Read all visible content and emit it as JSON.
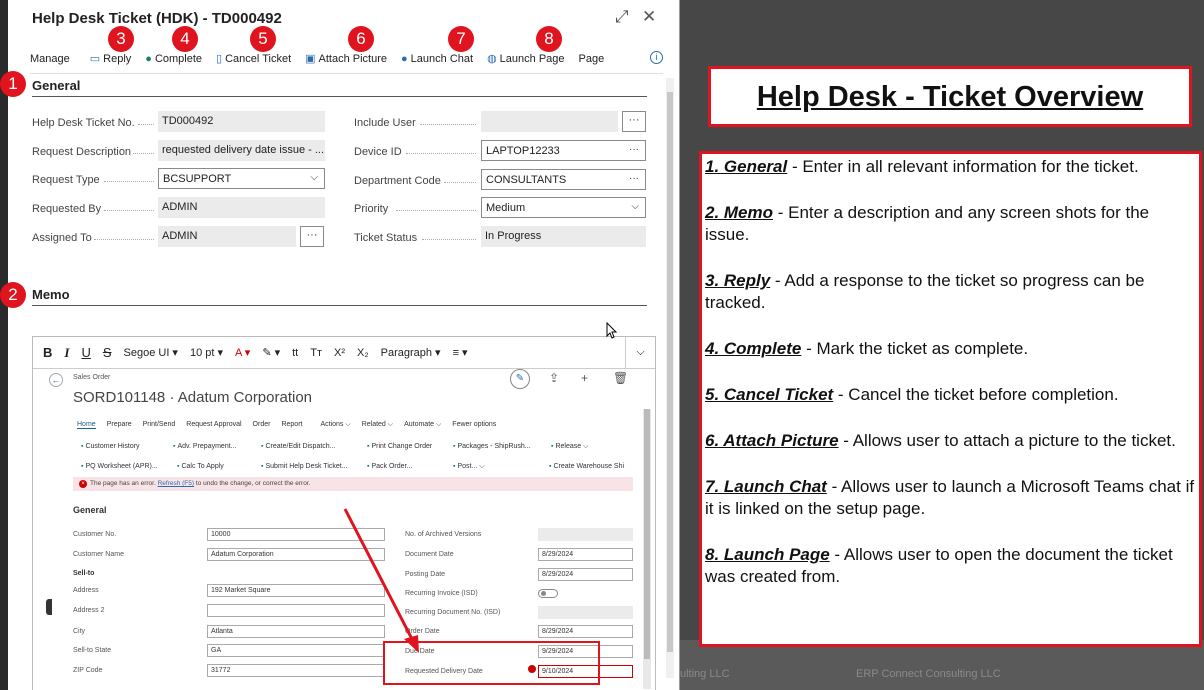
{
  "dialog": {
    "title": "Help Desk Ticket (HDK) - TD000492",
    "expand_glyph": "⤢",
    "close_glyph": "✕",
    "toolbar": {
      "manage": "Manage",
      "reply": "Reply",
      "complete": "Complete",
      "cancel_ticket": "Cancel Ticket",
      "attach_picture": "Attach Picture",
      "launch_chat": "Launch Chat",
      "launch_page": "Launch Page",
      "page": "Page",
      "info_glyph": "i"
    },
    "badges": [
      "1",
      "2",
      "3",
      "4",
      "5",
      "6",
      "7",
      "8"
    ],
    "general": {
      "heading": "General",
      "left_fields": [
        {
          "label": "Help Desk Ticket No.",
          "value": "TD000492"
        },
        {
          "label": "Request Description",
          "value": "requested delivery date issue - ..."
        },
        {
          "label": "Request Type",
          "value": "BCSUPPORT"
        },
        {
          "label": "Requested By",
          "value": "ADMIN"
        },
        {
          "label": "Assigned To",
          "value": "ADMIN"
        }
      ],
      "right_fields": [
        {
          "label": "Include User",
          "value": ""
        },
        {
          "label": "Device ID",
          "value": "LAPTOP12233"
        },
        {
          "label": "Department Code",
          "value": "CONSULTANTS"
        },
        {
          "label": "Priority",
          "value": "Medium"
        },
        {
          "label": "Ticket Status",
          "value": "In Progress"
        }
      ],
      "ellipsis": "···",
      "chevron": "⌵"
    },
    "memo": {
      "heading": "Memo",
      "editor_toolbar": {
        "bold": "B",
        "italic": "I",
        "underline": "U",
        "strike": "S",
        "font": "Segoe UI ▾",
        "size": "10 pt ▾",
        "font_color": "A ▾",
        "highlight": "✎ ▾",
        "tt_lower": "tt",
        "tt_upper": "Tт",
        "superscript": "X²",
        "subscript": "X₂",
        "paragraph": "Paragraph ▾",
        "align": "≡ ▾",
        "collapse": "⌵"
      }
    }
  },
  "embedded_screenshot": {
    "breadcrumb": "Sales Order",
    "title": "SORD101148 · Adatum Corporation",
    "tabs": [
      "Home",
      "Prepare",
      "Print/Send",
      "Request Approval",
      "Order",
      "Report",
      "Actions ⌵",
      "Related ⌵",
      "Automate ⌵",
      "Fewer options"
    ],
    "actions_row1": [
      "Customer History",
      "Adv. Prepayment...",
      "Create/Edit Dispatch...",
      "Print Change Order",
      "Packages - ShipRush...",
      "Release ⌵"
    ],
    "actions_row2": [
      "PQ Worksheet (APR)...",
      "Calc To Apply",
      "Submit Help Desk Ticket...",
      "Pack Order...",
      "Post... ⌵",
      "Create Warehouse Shi"
    ],
    "error_text_1": "The page has an error.",
    "error_link": "Refresh (F5)",
    "error_text_2": "to undo the change, or correct the error.",
    "section": "General",
    "left": [
      {
        "label": "Customer No.",
        "value": "10000"
      },
      {
        "label": "Customer Name",
        "value": "Adatum Corporation"
      },
      {
        "label": "Sell-to",
        "value": ""
      },
      {
        "label": "Address",
        "value": "192 Market Square"
      },
      {
        "label": "Address 2",
        "value": ""
      },
      {
        "label": "City",
        "value": "Atlanta"
      },
      {
        "label": "Sell-to State",
        "value": "GA"
      },
      {
        "label": "ZIP Code",
        "value": "31772"
      }
    ],
    "right": [
      {
        "label": "No. of Archived Versions",
        "value": ""
      },
      {
        "label": "Document Date",
        "value": "8/29/2024"
      },
      {
        "label": "Posting Date",
        "value": "8/29/2024"
      },
      {
        "label": "Recurring Invoice (ISD)",
        "value": ""
      },
      {
        "label": "Recurring Document No. (ISD)",
        "value": ""
      },
      {
        "label": "Order Date",
        "value": "8/29/2024"
      },
      {
        "label": "Due Date",
        "value": "9/29/2024"
      },
      {
        "label": "Requested Delivery Date",
        "value": "9/10/2024"
      }
    ]
  },
  "overview": {
    "title": "Help Desk - Ticket Overview",
    "items": [
      {
        "heading": "1. General",
        "text": " - Enter in all relevant information for the ticket."
      },
      {
        "heading": "2. Memo",
        "text": " - Enter a description and any screen shots for the issue."
      },
      {
        "heading": "3. Reply",
        "text": " - Add a response to the ticket so progress can be tracked."
      },
      {
        "heading": "4. Complete",
        "text": " - Mark the ticket as complete."
      },
      {
        "heading": "5. Cancel Ticket",
        "text": " - Cancel the ticket before completion."
      },
      {
        "heading": "6. Attach Picture",
        "text": " - Allows user to attach a picture to the ticket."
      },
      {
        "heading": "7. Launch Chat",
        "text": " - Allows user to launch a Microsoft Teams chat if it is linked on the setup page."
      },
      {
        "heading": "8. Launch Page",
        "text": " - Allows user to open the document the ticket was created from."
      }
    ]
  },
  "background": {
    "text_1": "ulting LLC",
    "text_2": "ERP Connect Consulting LLC"
  },
  "colors": {
    "accent_red": "#e0141e",
    "link_blue": "#2b6cb0",
    "action_green": "#1a7f64"
  }
}
